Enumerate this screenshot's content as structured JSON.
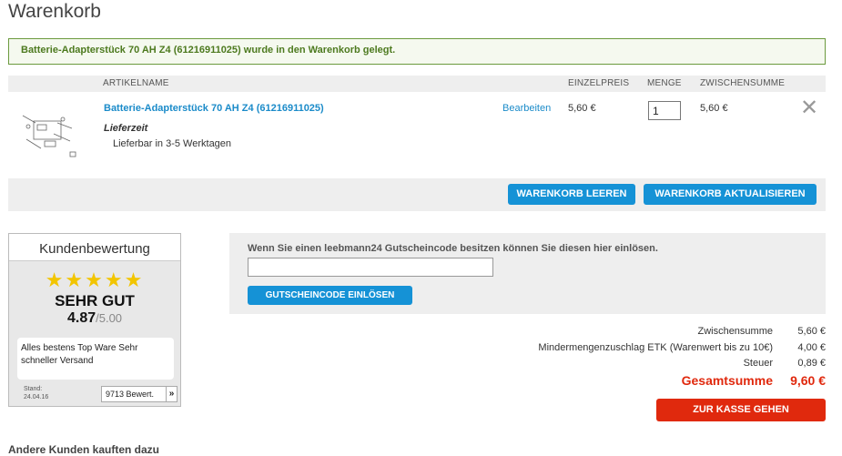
{
  "page": {
    "title": "Warenkorb"
  },
  "notice": "Batterie-Adapterstück 70 AH Z4 (61216911025) wurde in den Warenkorb gelegt.",
  "table": {
    "headers": {
      "name": "ARTIKELNAME",
      "unit_price": "EINZELPREIS",
      "quantity": "MENGE",
      "subtotal": "ZWISCHENSUMME"
    },
    "items": [
      {
        "name": "Batterie-Adapterstück 70 AH Z4 (61216911025)",
        "delivery_label": "Lieferzeit",
        "delivery_value": "Lieferbar in 3-5 Werktagen",
        "edit_label": "Bearbeiten",
        "unit_price": "5,60 €",
        "quantity": "1",
        "subtotal": "5,60 €",
        "remove_icon": "close-x-icon"
      }
    ]
  },
  "actions": {
    "empty_cart": "WARENKORB LEEREN",
    "update_cart": "WARENKORB AKTUALISIEREN"
  },
  "review": {
    "title": "Kundenbewertung",
    "stars": "★★★★★",
    "rating_word": "SEHR GUT",
    "score": "4.87",
    "score_max": "/5.00",
    "text": "Alles bestens Top Ware Sehr schneller Versand",
    "date_label": "Stand:",
    "date": "24.04.16",
    "count": "9713 Bewert.",
    "arrow": "»"
  },
  "coupon": {
    "label": "Wenn Sie einen leebmann24 Gutscheincode besitzen können Sie diesen hier einlösen.",
    "value": "",
    "button": "GUTSCHEINCODE EINLÖSEN"
  },
  "totals": {
    "subtotal_label": "Zwischensumme",
    "subtotal_value": "5,60 €",
    "surcharge_label": "Mindermengenzuschlag ETK (Warenwert bis zu 10€)",
    "surcharge_value": "4,00 €",
    "tax_label": "Steuer",
    "tax_value": "0,89 €",
    "grand_label": "Gesamtsumme",
    "grand_value": "9,60 €"
  },
  "checkout": {
    "button": "ZUR KASSE GEHEN"
  },
  "also_bought": {
    "heading": "Andere Kunden kauften dazu"
  },
  "colors": {
    "link": "#1b8bc9",
    "primary_button": "#1592d6",
    "checkout_button": "#e0290d",
    "success_border": "#6b9a3e",
    "stars": "#f2c500"
  }
}
